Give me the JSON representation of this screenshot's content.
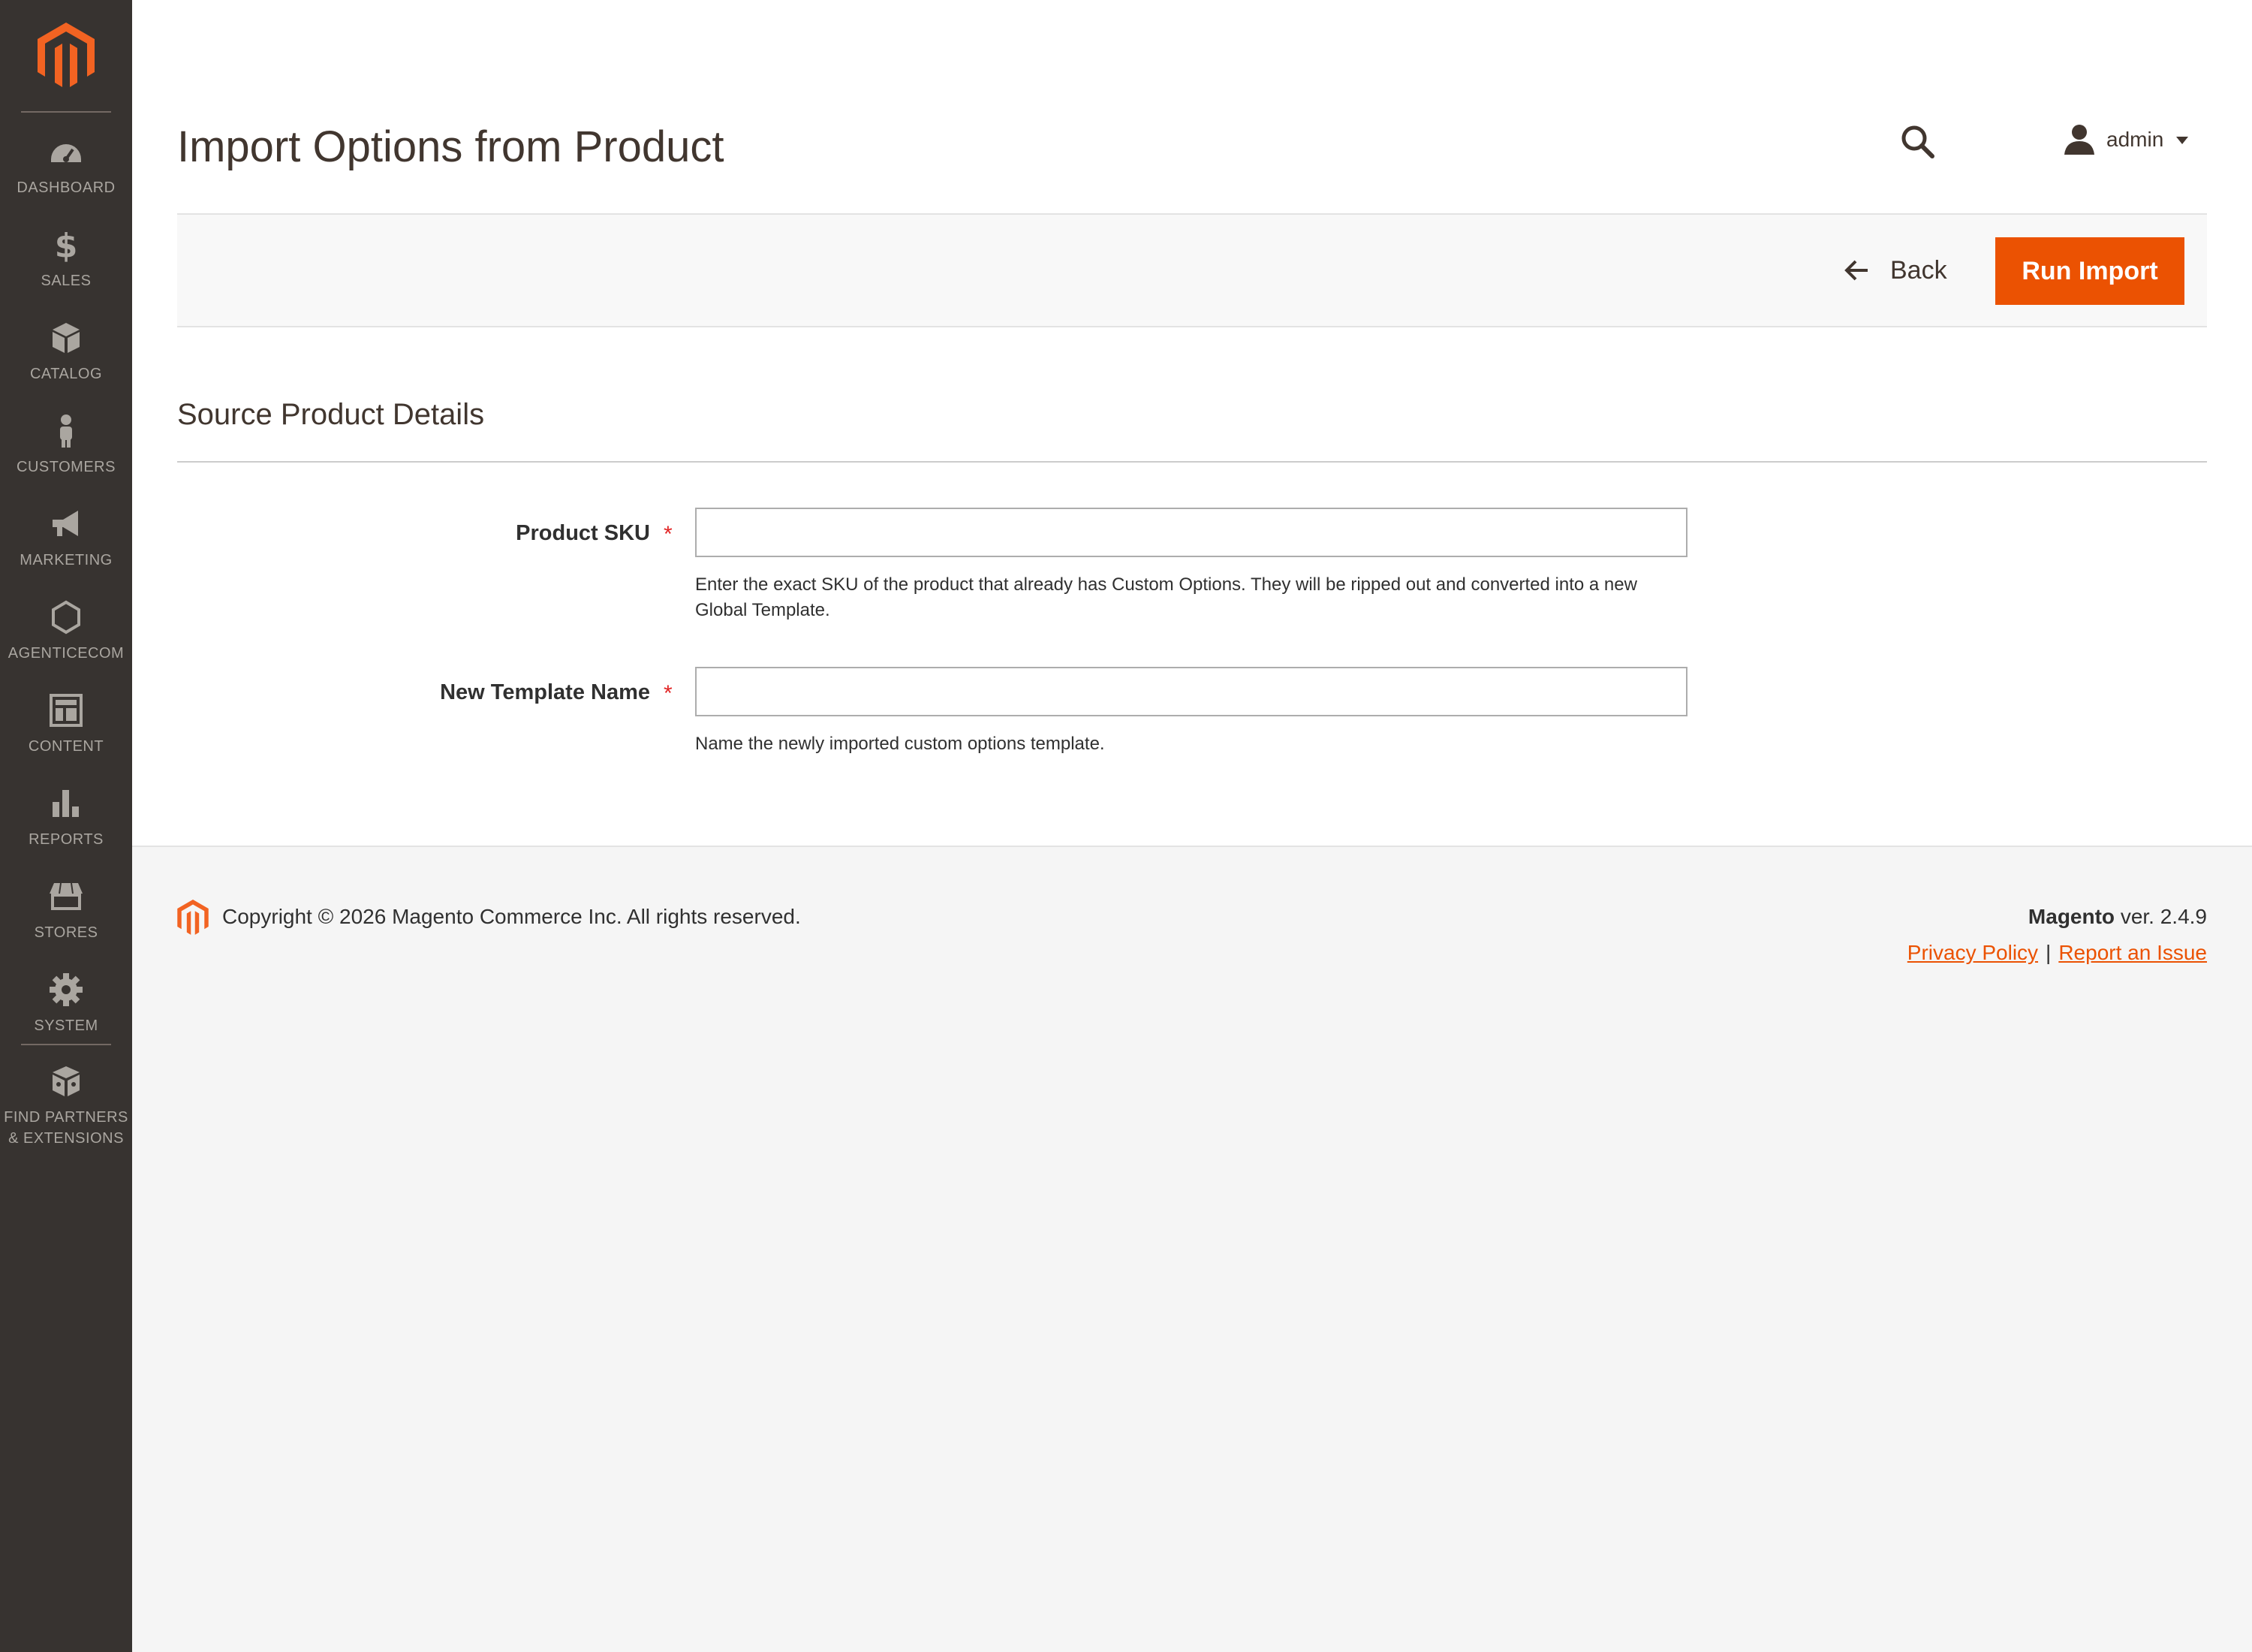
{
  "sidebar": {
    "items": [
      {
        "label": "DASHBOARD",
        "icon": "dashboard-icon"
      },
      {
        "label": "SALES",
        "icon": "dollar-icon"
      },
      {
        "label": "CATALOG",
        "icon": "box-icon"
      },
      {
        "label": "CUSTOMERS",
        "icon": "person-icon"
      },
      {
        "label": "MARKETING",
        "icon": "megaphone-icon"
      },
      {
        "label": "AGENTICECOM",
        "icon": "hexagon-icon"
      },
      {
        "label": "CONTENT",
        "icon": "layout-icon"
      },
      {
        "label": "REPORTS",
        "icon": "bar-chart-icon"
      },
      {
        "label": "STORES",
        "icon": "store-icon"
      },
      {
        "label": "SYSTEM",
        "icon": "gear-icon"
      },
      {
        "label": "FIND PARTNERS\n& EXTENSIONS",
        "line1": "FIND PARTNERS",
        "line2": "& EXTENSIONS",
        "icon": "extensions-icon"
      }
    ]
  },
  "header": {
    "title": "Import Options from Product",
    "user": "admin"
  },
  "actions": {
    "back_label": "Back",
    "run_import_label": "Run Import"
  },
  "section": {
    "title": "Source Product Details"
  },
  "form": {
    "sku": {
      "label": "Product SKU",
      "value": "",
      "note": "Enter the exact SKU of the product that already has Custom Options. They will be ripped out and converted into a new Global Template.",
      "note_line1": "Enter the exact SKU of the product that already has Custom Options. They will be ripped out and converted into a new",
      "note_line2": "Global Template."
    },
    "template_name": {
      "label": "New Template Name",
      "value": "",
      "note": "Name the newly imported custom options template."
    },
    "required_mark": "*"
  },
  "footer": {
    "copyright": "Copyright © 2026 Magento Commerce Inc. All rights reserved.",
    "brand": "Magento",
    "version": "ver. 2.4.9",
    "privacy_label": "Privacy Policy",
    "separator": "|",
    "report_label": "Report an Issue"
  },
  "colors": {
    "accent": "#eb5202",
    "sidebar_bg": "#373330",
    "required": "#e22626"
  }
}
